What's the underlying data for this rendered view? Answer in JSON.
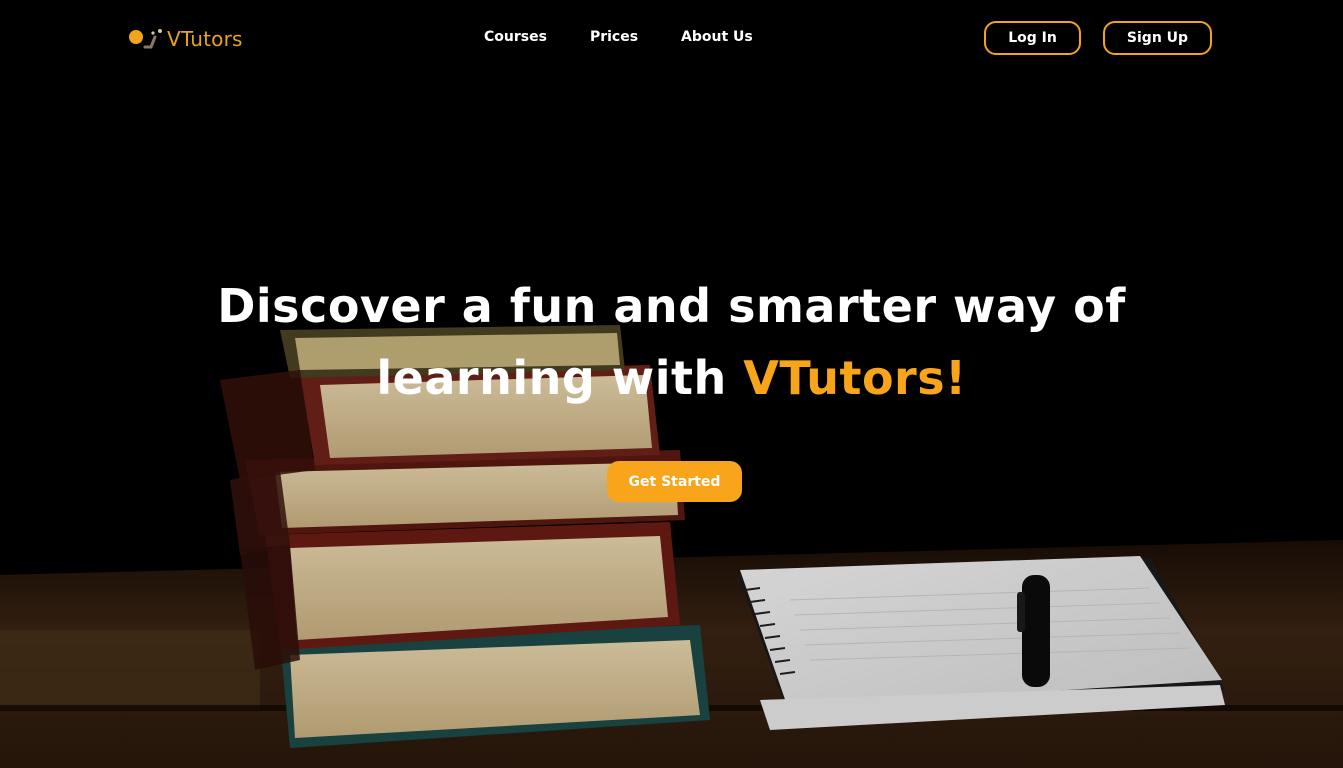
{
  "brand": {
    "name": "VTutors",
    "accent_color": "#f8a51b"
  },
  "nav": {
    "links": [
      "Courses",
      "Prices",
      "About Us"
    ],
    "login_label": "Log In",
    "signup_label": "Sign Up"
  },
  "hero": {
    "line1": "Discover a fun and smarter way of",
    "line2_prefix": "learning with ",
    "line2_accent": "VTutors!",
    "cta_label": "Get Started"
  }
}
